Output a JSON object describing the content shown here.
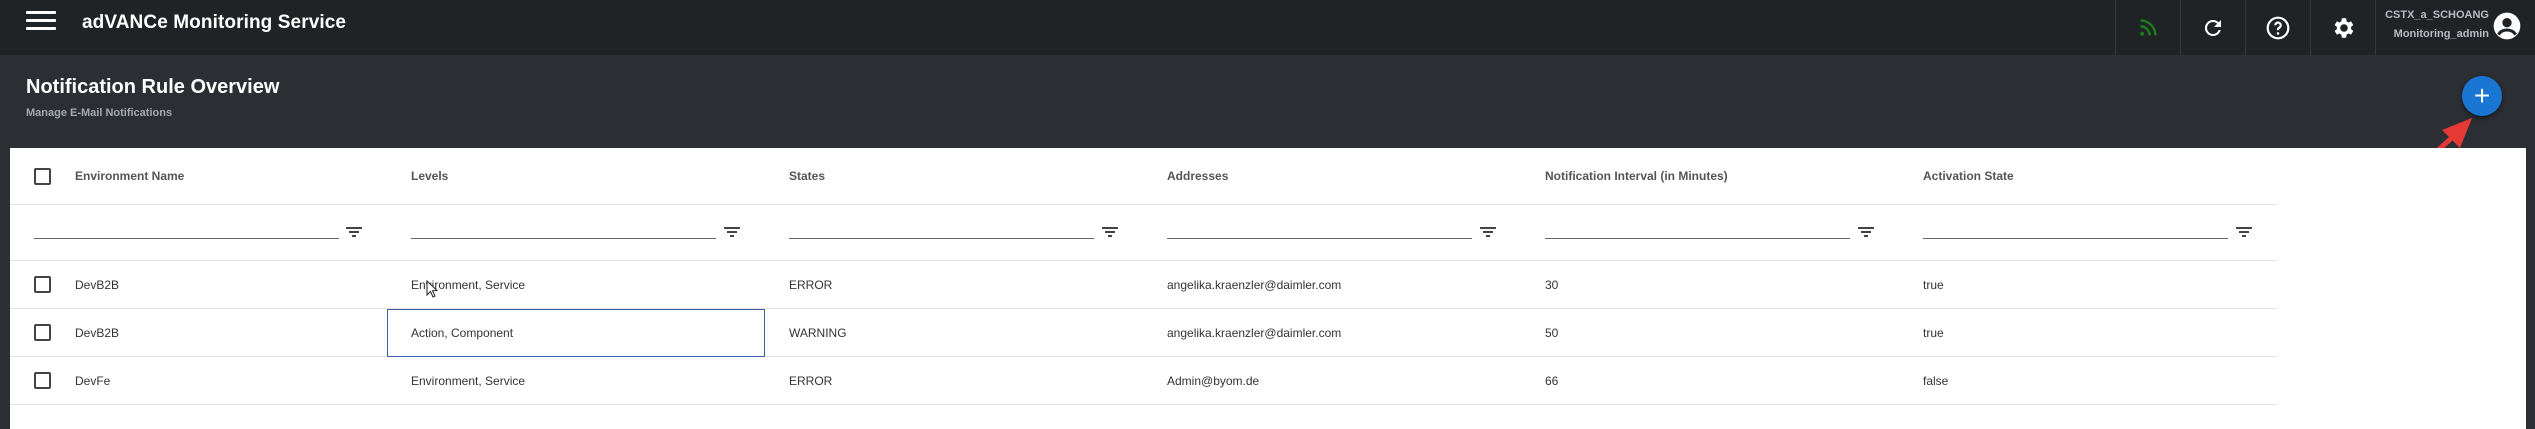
{
  "app": {
    "title": "adVANCe Monitoring Service"
  },
  "user": {
    "name": "CSTX_a_SCHOANG",
    "role": "Monitoring_admin"
  },
  "page": {
    "title": "Notification Rule Overview",
    "subtitle": "Manage E-Mail Notifications",
    "add_button": "+"
  },
  "colors": {
    "topbar": "#1f2326",
    "background": "#2b2f33",
    "accent": "#1976d2",
    "feed": "#1e7a1e",
    "annotation": "#e53935"
  },
  "table": {
    "columns": [
      "Environment Name",
      "Levels",
      "States",
      "Addresses",
      "Notification Interval (in Minutes)",
      "Activation State"
    ],
    "rows": [
      {
        "environment": "DevB2B",
        "levels": "Environment, Service",
        "states": "ERROR",
        "addresses": "angelika.kraenzler@daimler.com",
        "interval": "30",
        "activation": "true"
      },
      {
        "environment": "DevB2B",
        "levels": "Action, Component",
        "states": "WARNING",
        "addresses": "angelika.kraenzler@daimler.com",
        "interval": "50",
        "activation": "true"
      },
      {
        "environment": "DevFe",
        "levels": "Environment, Service",
        "states": "ERROR",
        "addresses": "Admin@byom.de",
        "interval": "66",
        "activation": "false"
      }
    ]
  },
  "icons": {
    "menu": "menu-icon",
    "feed": "rss-feed-icon",
    "refresh": "refresh-icon",
    "help": "help-icon",
    "settings": "gear-icon",
    "avatar": "account-circle-icon",
    "filter": "filter-icon"
  }
}
